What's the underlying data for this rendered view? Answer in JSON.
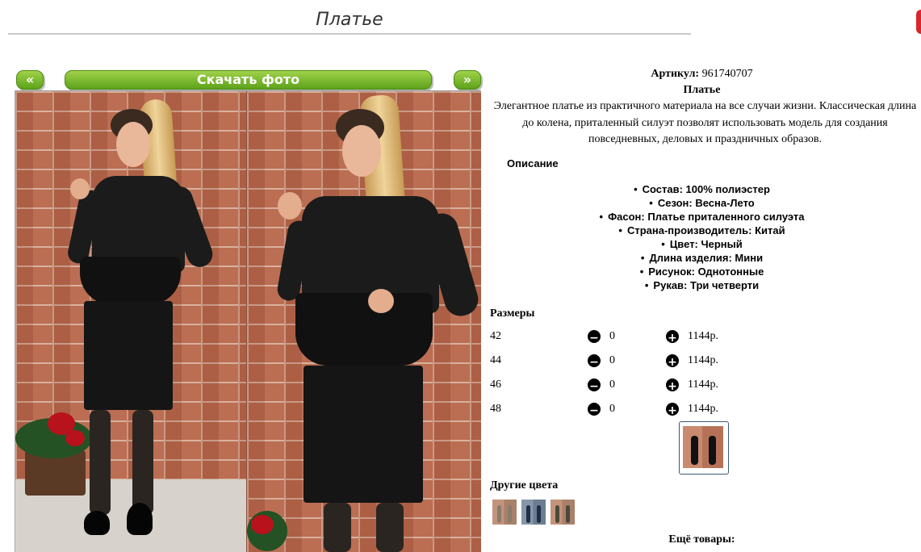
{
  "page": {
    "title": "Платье"
  },
  "gallery": {
    "prev_label": "«",
    "next_label": "»",
    "download_label": "Скачать фото"
  },
  "product": {
    "article_label": "Артикул:",
    "article_value": "961740707",
    "name": "Платье",
    "description": "Элегантное платье из практичного материала на все случаи жизни. Классическая длина до колена, приталенный силуэт позволят использовать модель для создания повседневных, деловых и праздничных образов.",
    "description_heading": "Описание",
    "properties": [
      "Состав: 100% полиэстер",
      "Сезон: Весна-Лето",
      "Фасон: Платье приталенного силуэта",
      "Страна-производитель: Китай",
      "Цвет: Черный",
      "Длина изделия: Мини",
      "Рисунок: Однотонные",
      "Рукав: Три четверти"
    ]
  },
  "sizes": {
    "heading": "Размеры",
    "minus_icon": "minus-circle-icon",
    "plus_icon": "plus-circle-icon",
    "minus_symbol": "−",
    "plus_symbol": "+",
    "rows": [
      {
        "size": "42",
        "qty": "0",
        "price": "1144р."
      },
      {
        "size": "44",
        "qty": "0",
        "price": "1144р."
      },
      {
        "size": "46",
        "qty": "0",
        "price": "1144р."
      },
      {
        "size": "48",
        "qty": "0",
        "price": "1144р."
      }
    ]
  },
  "other_colors": {
    "heading": "Другие цвета"
  },
  "more_products": {
    "heading": "Ещё товары:"
  },
  "colors": {
    "accent_green": "#6aae20",
    "title_rule": "#c9c9c9",
    "brand_red": "#d9262c"
  }
}
